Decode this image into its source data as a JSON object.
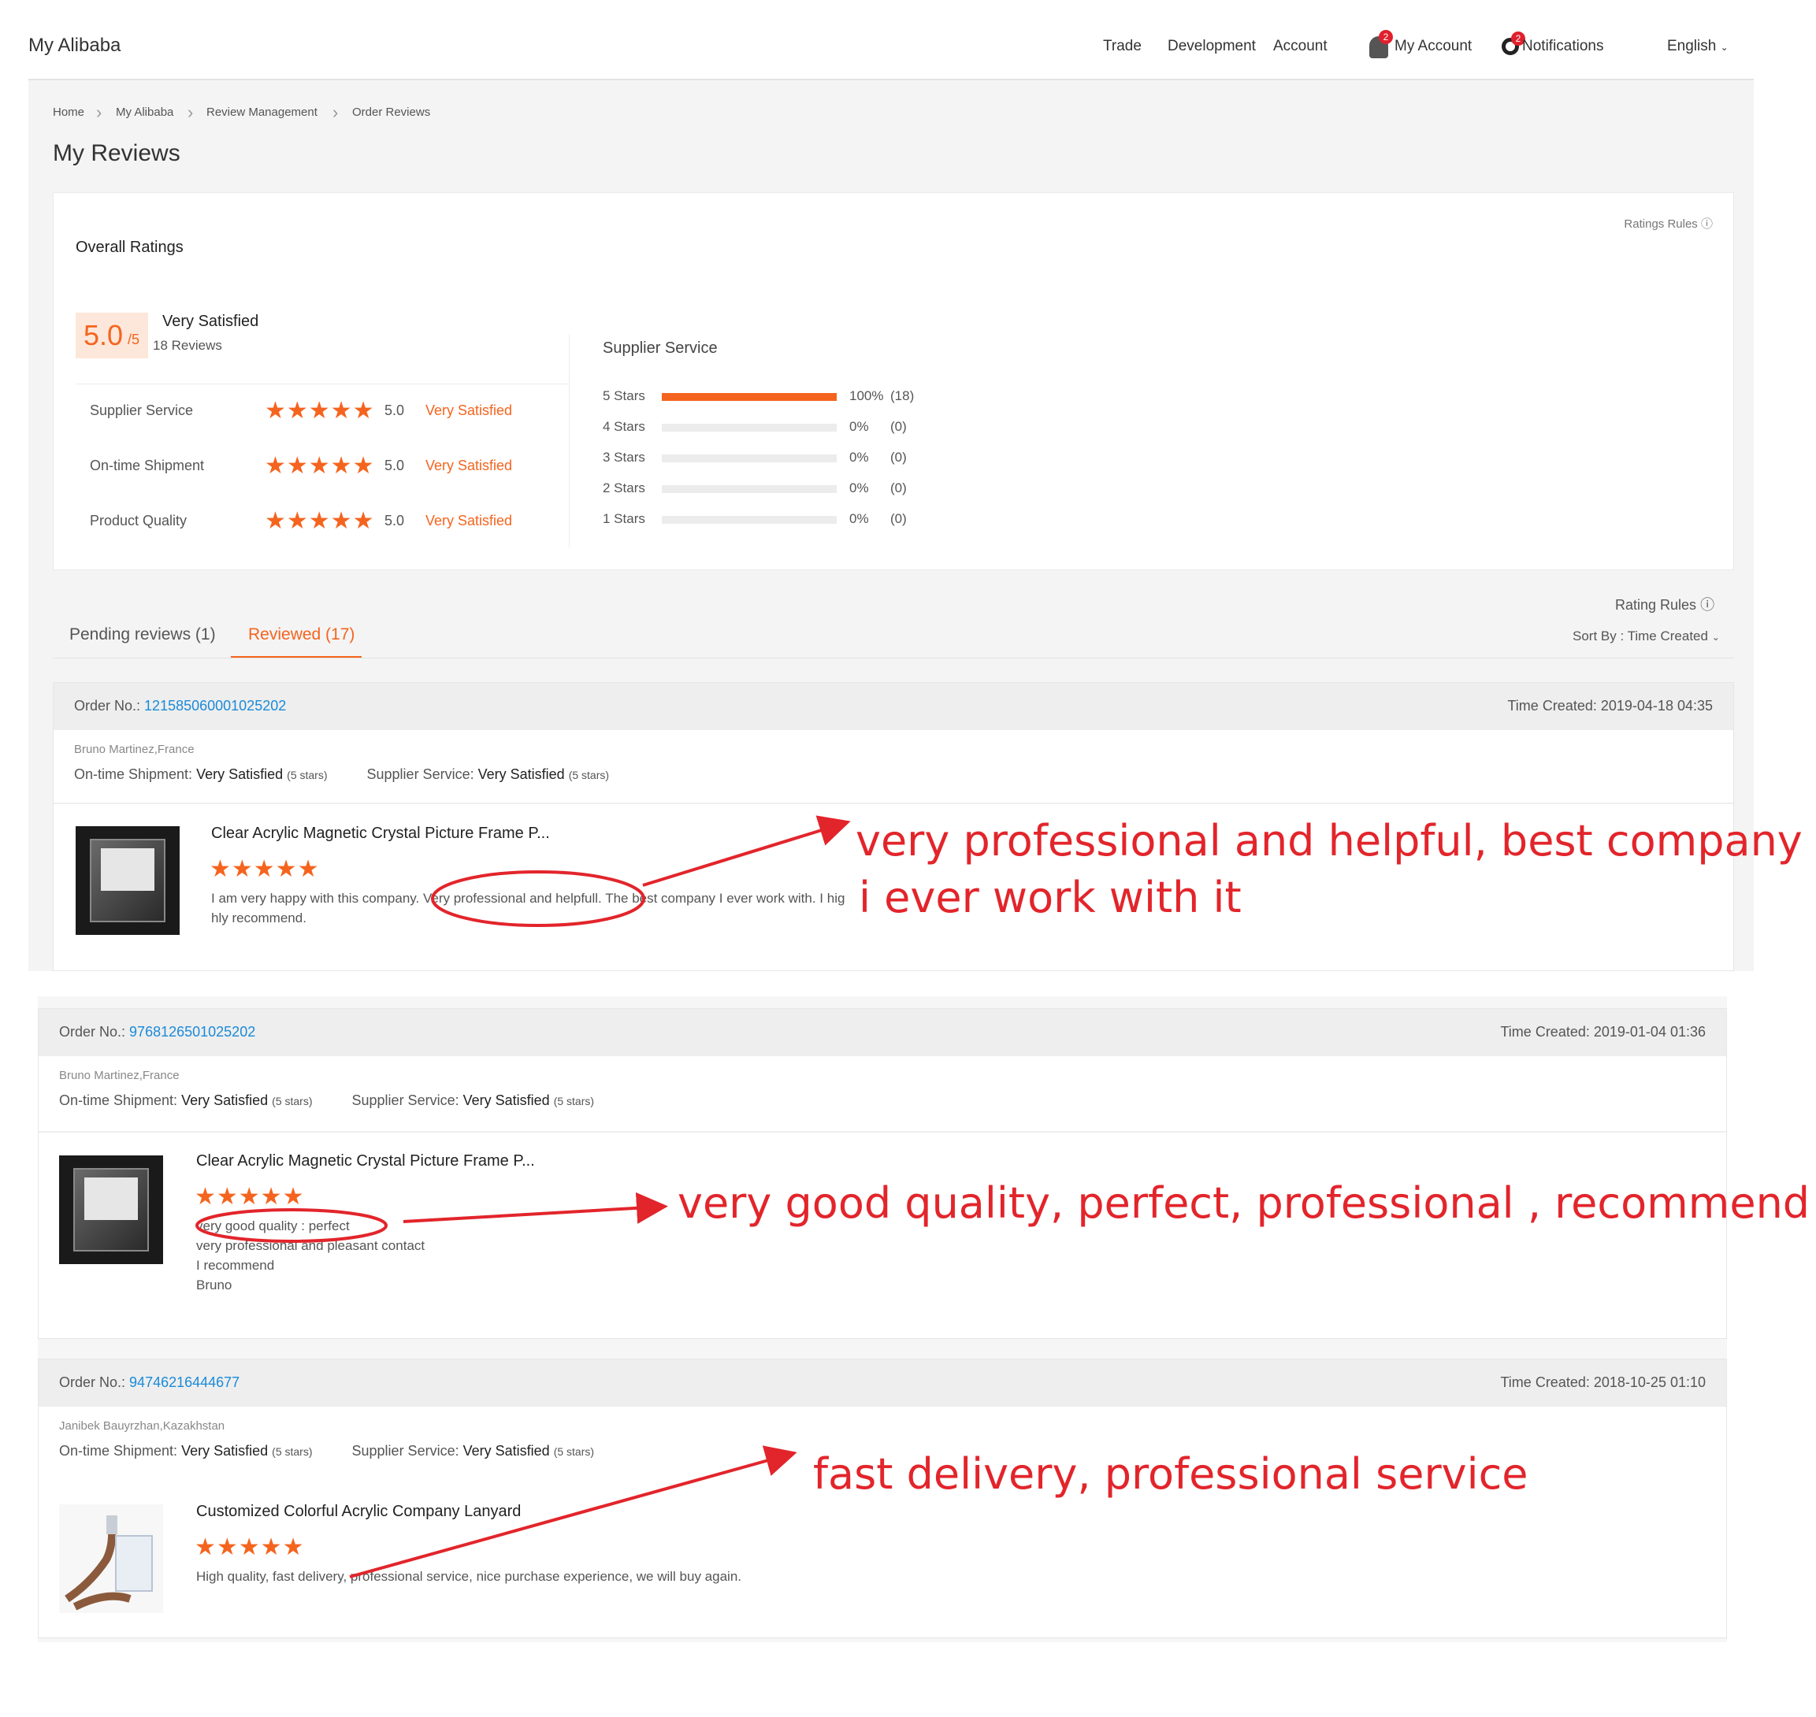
{
  "header": {
    "brand": "My Alibaba",
    "nav": [
      "Trade",
      "Development",
      "Account"
    ],
    "my_account": "My Account",
    "notifications": "Notifications",
    "language": "English",
    "badge_count": "2"
  },
  "breadcrumb": [
    "Home",
    "My Alibaba",
    "Review Management",
    "Order Reviews"
  ],
  "page_title": "My Reviews",
  "overall": {
    "heading": "Overall Ratings",
    "ratings_rules": "Ratings Rules",
    "score": "5.0",
    "score_suffix": "/5",
    "summary": "Very Satisfied",
    "review_count": "18 Reviews",
    "categories": [
      {
        "name": "Supplier Service",
        "score": "5.0",
        "label": "Very Satisfied",
        "stars": 5
      },
      {
        "name": "On-time Shipment",
        "score": "5.0",
        "label": "Very Satisfied",
        "stars": 5
      },
      {
        "name": "Product Quality",
        "score": "5.0",
        "label": "Very Satisfied",
        "stars": 5
      }
    ],
    "breakdown_title": "Supplier Service",
    "breakdown": [
      {
        "label": "5 Stars",
        "pct": "100%",
        "count": "(18)",
        "fraction": 1.0
      },
      {
        "label": "4 Stars",
        "pct": "0%",
        "count": "(0)",
        "fraction": 0
      },
      {
        "label": "3 Stars",
        "pct": "0%",
        "count": "(0)",
        "fraction": 0
      },
      {
        "label": "2 Stars",
        "pct": "0%",
        "count": "(0)",
        "fraction": 0
      },
      {
        "label": "1 Stars",
        "pct": "0%",
        "count": "(0)",
        "fraction": 0
      }
    ]
  },
  "tabs": {
    "pending": "Pending reviews (1)",
    "reviewed": "Reviewed (17)",
    "rating_rules": "Rating Rules",
    "sort_by": "Sort By : Time Created"
  },
  "labels": {
    "order_no": "Order No.:",
    "time_created": "Time Created:",
    "on_time": "On-time Shipment:",
    "supplier_service": "Supplier Service:",
    "very_satisfied": "Very Satisfied",
    "five_stars": "(5 stars)"
  },
  "orders": [
    {
      "order_no": "121585060001025202",
      "time_created": "2019-04-18 04:35",
      "buyer": "Bruno Martinez,France",
      "product": "Clear Acrylic Magnetic Crystal Picture Frame P...",
      "review_lines": [
        "I am very happy with this company. Very professional and helpfull. The best company I ever work with. I hig",
        "hly recommend."
      ]
    },
    {
      "order_no": "9768126501025202",
      "time_created": "2019-01-04 01:36",
      "buyer": "Bruno Martinez,France",
      "product": "Clear Acrylic Magnetic Crystal Picture Frame P...",
      "review_lines": [
        "very good quality : perfect",
        "very professional and pleasant contact",
        "I recommend",
        "Bruno"
      ]
    },
    {
      "order_no": "94746216444677",
      "time_created": "2018-10-25 01:10",
      "buyer": "Janibek Bauyrzhan,Kazakhstan",
      "product": "Customized Colorful Acrylic Company Lanyard",
      "review_lines": [
        "High quality, fast delivery, professional service, nice purchase experience, we will buy again."
      ]
    }
  ],
  "annotations": [
    {
      "line1": "very professional and helpful, best company",
      "line2": "i ever work with it"
    },
    {
      "line1": "very good quality, perfect, professional , recommend"
    },
    {
      "line1": "fast delivery, professional service"
    }
  ],
  "colors": {
    "accent": "#f5641e",
    "link": "#1a8ad8",
    "annotation": "#e2252b"
  }
}
